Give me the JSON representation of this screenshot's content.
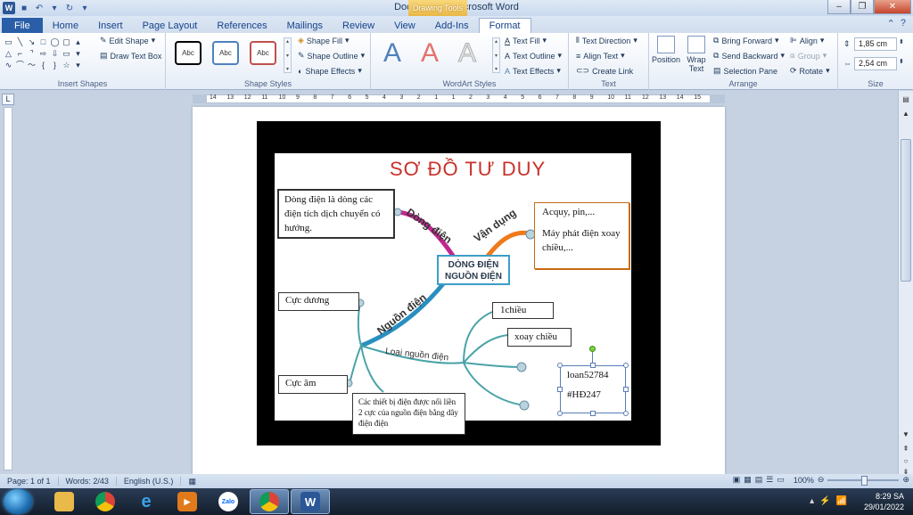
{
  "window": {
    "title": "Document1 - Microsoft Word",
    "context_tab": "Drawing Tools"
  },
  "tabs": [
    "File",
    "Home",
    "Insert",
    "Page Layout",
    "References",
    "Mailings",
    "Review",
    "View",
    "Add-Ins",
    "Format"
  ],
  "active_tab": "Format",
  "ribbon": {
    "insert_shapes": {
      "label": "Insert Shapes",
      "edit_shape": "Edit Shape",
      "draw_text_box": "Draw Text Box"
    },
    "shape_styles": {
      "label": "Shape Styles",
      "sample": "Abc",
      "shape_fill": "Shape Fill",
      "shape_outline": "Shape Outline",
      "shape_effects": "Shape Effects"
    },
    "wordart_styles": {
      "label": "WordArt Styles",
      "letter": "A",
      "text_fill": "Text Fill",
      "text_outline": "Text Outline",
      "text_effects": "Text Effects"
    },
    "text": {
      "label": "Text",
      "text_direction": "Text Direction",
      "align_text": "Align Text",
      "create_link": "Create Link"
    },
    "arrange": {
      "label": "Arrange",
      "position": "Position",
      "wrap_text": "Wrap Text",
      "bring_forward": "Bring Forward",
      "send_backward": "Send Backward",
      "selection_pane": "Selection Pane",
      "align": "Align",
      "group": "Group",
      "rotate": "Rotate"
    },
    "size": {
      "label": "Size",
      "height": "1,85 cm",
      "width": "2,54 cm"
    }
  },
  "ruler": {
    "numbers": [
      "14",
      "13",
      "12",
      "11",
      "10",
      "9",
      "8",
      "7",
      "6",
      "5",
      "4",
      "3",
      "2",
      "1",
      "1",
      "2",
      "3",
      "4",
      "5",
      "6",
      "7",
      "8",
      "9",
      "10",
      "11",
      "12",
      "13",
      "14",
      "15"
    ]
  },
  "mindmap": {
    "title": "SƠ ĐỒ TƯ DUY",
    "center": "DÒNG ĐIỆN\nNGUỒN ĐIỆN",
    "branches": {
      "dong_dien": "Dòng điện",
      "van_dung": "Vận dụng",
      "nguon_dien": "Nguồn điện",
      "loai_nguon_dien": "Loại nguồn điện"
    },
    "boxes": {
      "definition": "Dòng điện là dòng các điện tích dịch chuyển có hướng.",
      "applications_1": "Acquy, pin,...",
      "applications_2": "Máy phát điện xoay chiều,...",
      "positive": "Cực dương",
      "negative": "Cực âm",
      "one_direction": "1chiều",
      "alternating": "xoay chiều",
      "wiring_note": "Các thiết bị điện được nối liền 2 cực của nguồn điện bằng dây điện điện",
      "selected_line_1": "loan52784",
      "selected_line_2": "#HĐ247"
    }
  },
  "status": {
    "page": "Page: 1 of 1",
    "words": "Words: 2/43",
    "language": "English (U.S.)",
    "zoom": "100%"
  },
  "taskbar": {
    "apps": [
      "explorer",
      "chrome",
      "internet-explorer",
      "media-player",
      "zalo",
      "chrome",
      "word"
    ],
    "zalo_label": "Zalo",
    "word_label": "W",
    "time": "8:29 SA",
    "date": "29/01/2022"
  },
  "colors": {
    "accent": "#2b579a",
    "drawing_tools": "#eab84a",
    "mindmap_title": "#c9312b",
    "branch_dong_dien": "#c0288e",
    "branch_van_dung": "#ee7a1c",
    "branch_nguon_dien": "#2a8fc0",
    "branch_loai": "#4aa3a8"
  }
}
